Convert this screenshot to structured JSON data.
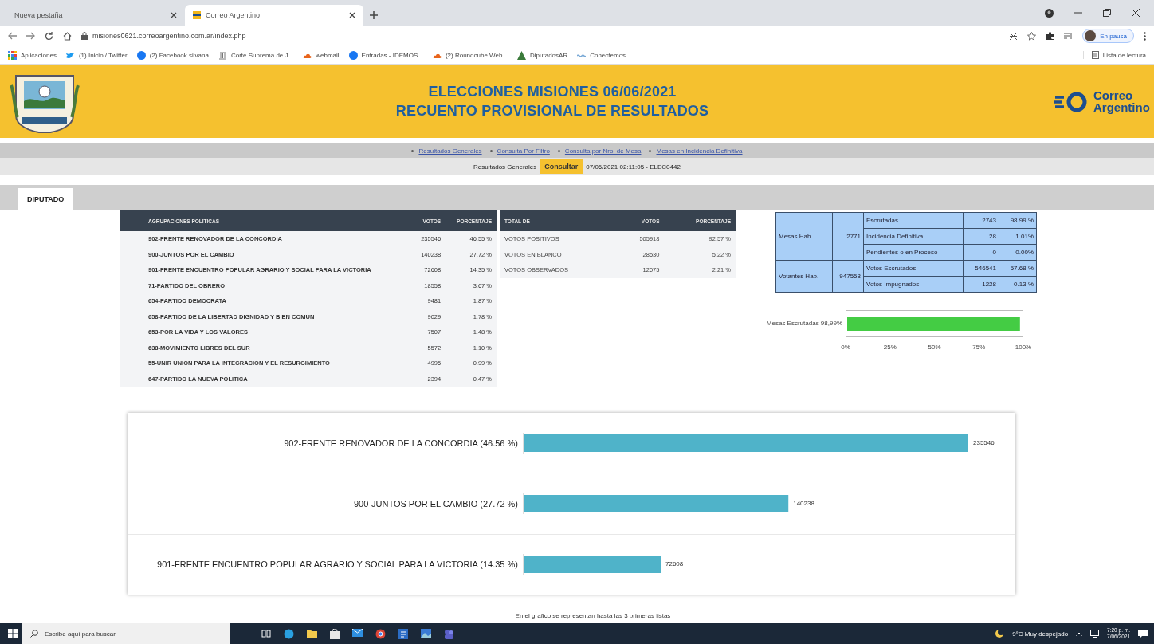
{
  "browser": {
    "tabs": [
      {
        "title": "Nueva pestaña",
        "selected": false
      },
      {
        "title": "Correo Argentino",
        "selected": true
      }
    ],
    "url": "misiones0621.correoargentino.com.ar/index.php",
    "profile": "En pausa",
    "bookmarks": [
      {
        "label": "Aplicaciones",
        "kind": "grid"
      },
      {
        "label": "(1) Inicio / Twitter",
        "kind": "bird"
      },
      {
        "label": "(2) Facebook silvana",
        "kind": "disc"
      },
      {
        "label": "Corte Suprema de J...",
        "kind": "column"
      },
      {
        "label": "webmail",
        "kind": "cloud"
      },
      {
        "label": "Entradas - IDEMOS...",
        "kind": "disc"
      },
      {
        "label": "(2) Roundcube Web...",
        "kind": "cloud"
      },
      {
        "label": "DiputadosAR",
        "kind": "triangle"
      },
      {
        "label": "Conectemos",
        "kind": "wave"
      }
    ],
    "reading_list": "Lista de lectura"
  },
  "header": {
    "title_lines": [
      "ELECCIONES MISIONES 06/06/2021",
      "RECUENTO PROVISIONAL DE RESULTADOS"
    ],
    "logo_text": "Correo Argentino"
  },
  "nav": {
    "links": [
      "Resultados Generales",
      "Consulta Por Filtro",
      "Consulta por Nro. de Mesa",
      "Mesas en Incidencia Definitiva"
    ]
  },
  "query": {
    "label": "Resultados Generales",
    "button": "Consultar",
    "timestamp": "07/06/2021 02:11:05 - ELEC0442"
  },
  "section_tabs": [
    {
      "label": "DIPUTADO",
      "selected": true
    }
  ],
  "parties_table": {
    "columns": [
      "AGRUPACIONES POLITICAS",
      "VOTOS",
      "PORCENTAJE"
    ],
    "rows": [
      {
        "name": "902-FRENTE RENOVADOR DE LA CONCORDIA",
        "votes": "235546",
        "percent": "46.55 %"
      },
      {
        "name": "900-JUNTOS POR EL CAMBIO",
        "votes": "140238",
        "percent": "27.72 %"
      },
      {
        "name": "901-FRENTE ENCUENTRO POPULAR AGRARIO Y SOCIAL PARA LA VICTORIA",
        "votes": "72608",
        "percent": "14.35 %"
      },
      {
        "name": "71-PARTIDO DEL OBRERO",
        "votes": "18558",
        "percent": "3.67 %"
      },
      {
        "name": "654-PARTIDO DEMOCRATA",
        "votes": "9481",
        "percent": "1.87 %"
      },
      {
        "name": "658-PARTIDO DE LA LIBERTAD DIGNIDAD Y BIEN COMUN",
        "votes": "9029",
        "percent": "1.78 %"
      },
      {
        "name": "653-POR LA VIDA Y LOS VALORES",
        "votes": "7507",
        "percent": "1.48 %"
      },
      {
        "name": "638-MOVIMIENTO LIBRES DEL SUR",
        "votes": "5572",
        "percent": "1.10 %"
      },
      {
        "name": "55-UNIR UNION PARA LA INTEGRACION Y EL RESURGIMIENTO",
        "votes": "4995",
        "percent": "0.99 %"
      },
      {
        "name": "647-PARTIDO LA NUEVA POLITICA",
        "votes": "2394",
        "percent": "0.47 %"
      }
    ]
  },
  "totals_table": {
    "columns": [
      "TOTAL DE",
      "VOTOS",
      "PORCENTAJE"
    ],
    "rows": [
      {
        "name": "VOTOS POSITIVOS",
        "votes": "505918",
        "percent": "92.57 %"
      },
      {
        "name": "VOTOS EN BLANCO",
        "votes": "28530",
        "percent": "5.22 %"
      },
      {
        "name": "VOTOS OBSERVADOS",
        "votes": "12075",
        "percent": "2.21 %"
      }
    ]
  },
  "summary_table": {
    "groups": [
      {
        "label": "Mesas Hab.",
        "value": "2771",
        "rows": [
          {
            "label": "Escrutadas",
            "value": "2743",
            "percent": "98.99 %"
          },
          {
            "label": "Incidencia Definitiva",
            "value": "28",
            "percent": "1.01%"
          },
          {
            "label": "Pendientes o en Proceso",
            "value": "0",
            "percent": "0.00%"
          }
        ]
      },
      {
        "label": "Votantes Hab.",
        "value": "947558",
        "rows": [
          {
            "label": "Votos Escrutados",
            "value": "546541",
            "percent": "57.68 %"
          },
          {
            "label": "Votos Impugnados",
            "value": "1228",
            "percent": "0.13 %"
          }
        ]
      }
    ]
  },
  "progress_chart": {
    "chart_data": {
      "type": "bar",
      "orientation": "horizontal",
      "categories": [
        "Mesas Escrutadas 98,99%"
      ],
      "series": [
        {
          "color": "#44cc44",
          "values": [
            99
          ]
        }
      ],
      "xlim": [
        0,
        100
      ],
      "xticks": [
        {
          "value": 0,
          "label": "0%"
        },
        {
          "value": 25,
          "label": "25%"
        },
        {
          "value": 50,
          "label": "50%"
        },
        {
          "value": 75,
          "label": "75%"
        },
        {
          "value": 100,
          "label": "100%"
        }
      ]
    }
  },
  "results_chart": {
    "chart_data": {
      "type": "bar",
      "orientation": "horizontal",
      "categories": [
        "902-FRENTE RENOVADOR DE LA CONCORDIA  (46.56 %)",
        "900-JUNTOS POR EL CAMBIO  (27.72 %)",
        "901-FRENTE ENCUENTRO POPULAR AGRARIO Y SOCIAL PARA LA VICTORIA  (14.35 %)"
      ],
      "series": [
        {
          "color": "#4fb3c9",
          "values": [
            235546,
            140238,
            72608
          ]
        }
      ],
      "data_labels": true
    }
  },
  "footnote": "En el grafico se representan hasta las 3 primeras listas",
  "taskbar": {
    "search_placeholder": "Escribe aquí para buscar",
    "weather": "9°C Muy despejado",
    "time": "7:20 p. m.",
    "date": "7/06/2021"
  }
}
